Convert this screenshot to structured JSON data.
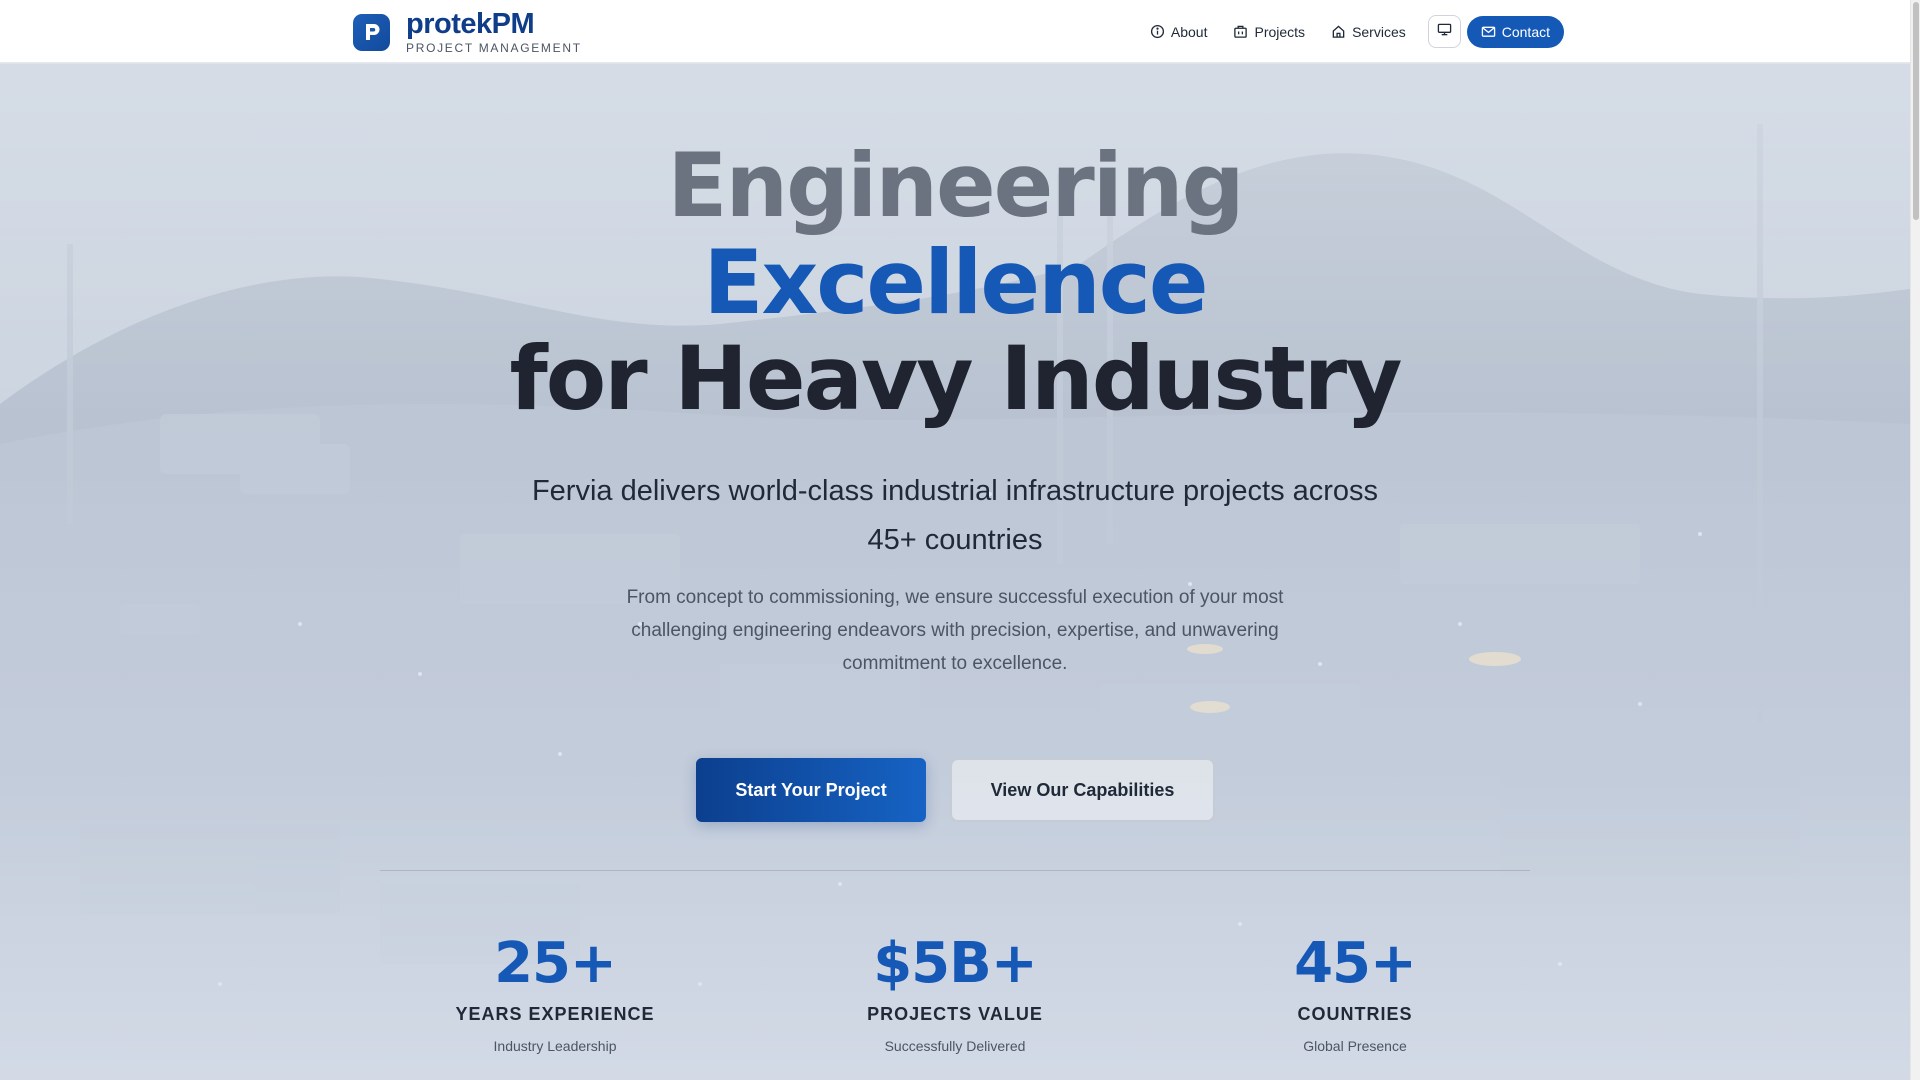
{
  "brand": {
    "name": "protekPM",
    "tagline": "PROJECT MANAGEMENT"
  },
  "nav": {
    "items": [
      {
        "label": "About",
        "icon": "info-circle-icon"
      },
      {
        "label": "Projects",
        "icon": "building-icon"
      },
      {
        "label": "Services",
        "icon": "home-icon"
      }
    ],
    "theme_icon": "monitor-icon",
    "contact": {
      "label": "Contact",
      "icon": "mail-icon"
    }
  },
  "hero": {
    "headline_line1": "Engineering",
    "headline_line2": "Excellence",
    "headline_line3": "for Heavy Industry",
    "subheadline": "Fervia delivers world-class industrial infrastructure projects across 45+ countries",
    "description": "From concept to commissioning, we ensure successful execution of your most challenging engineering endeavors with precision, expertise, and unwavering commitment to excellence.",
    "primary_cta": "Start Your Project",
    "secondary_cta": "View Our Capabilities"
  },
  "stats": [
    {
      "value": "25+",
      "label": "YEARS EXPERIENCE",
      "sub": "Industry Leadership"
    },
    {
      "value": "$5B+",
      "label": "PROJECTS VALUE",
      "sub": "Successfully Delivered"
    },
    {
      "value": "45+",
      "label": "COUNTRIES",
      "sub": "Global Presence"
    }
  ],
  "colors": {
    "brand_blue": "#1558b5",
    "dark_blue": "#0f3d8a",
    "headline_gray": "#6b7280",
    "headline_dark": "#1f2430"
  }
}
